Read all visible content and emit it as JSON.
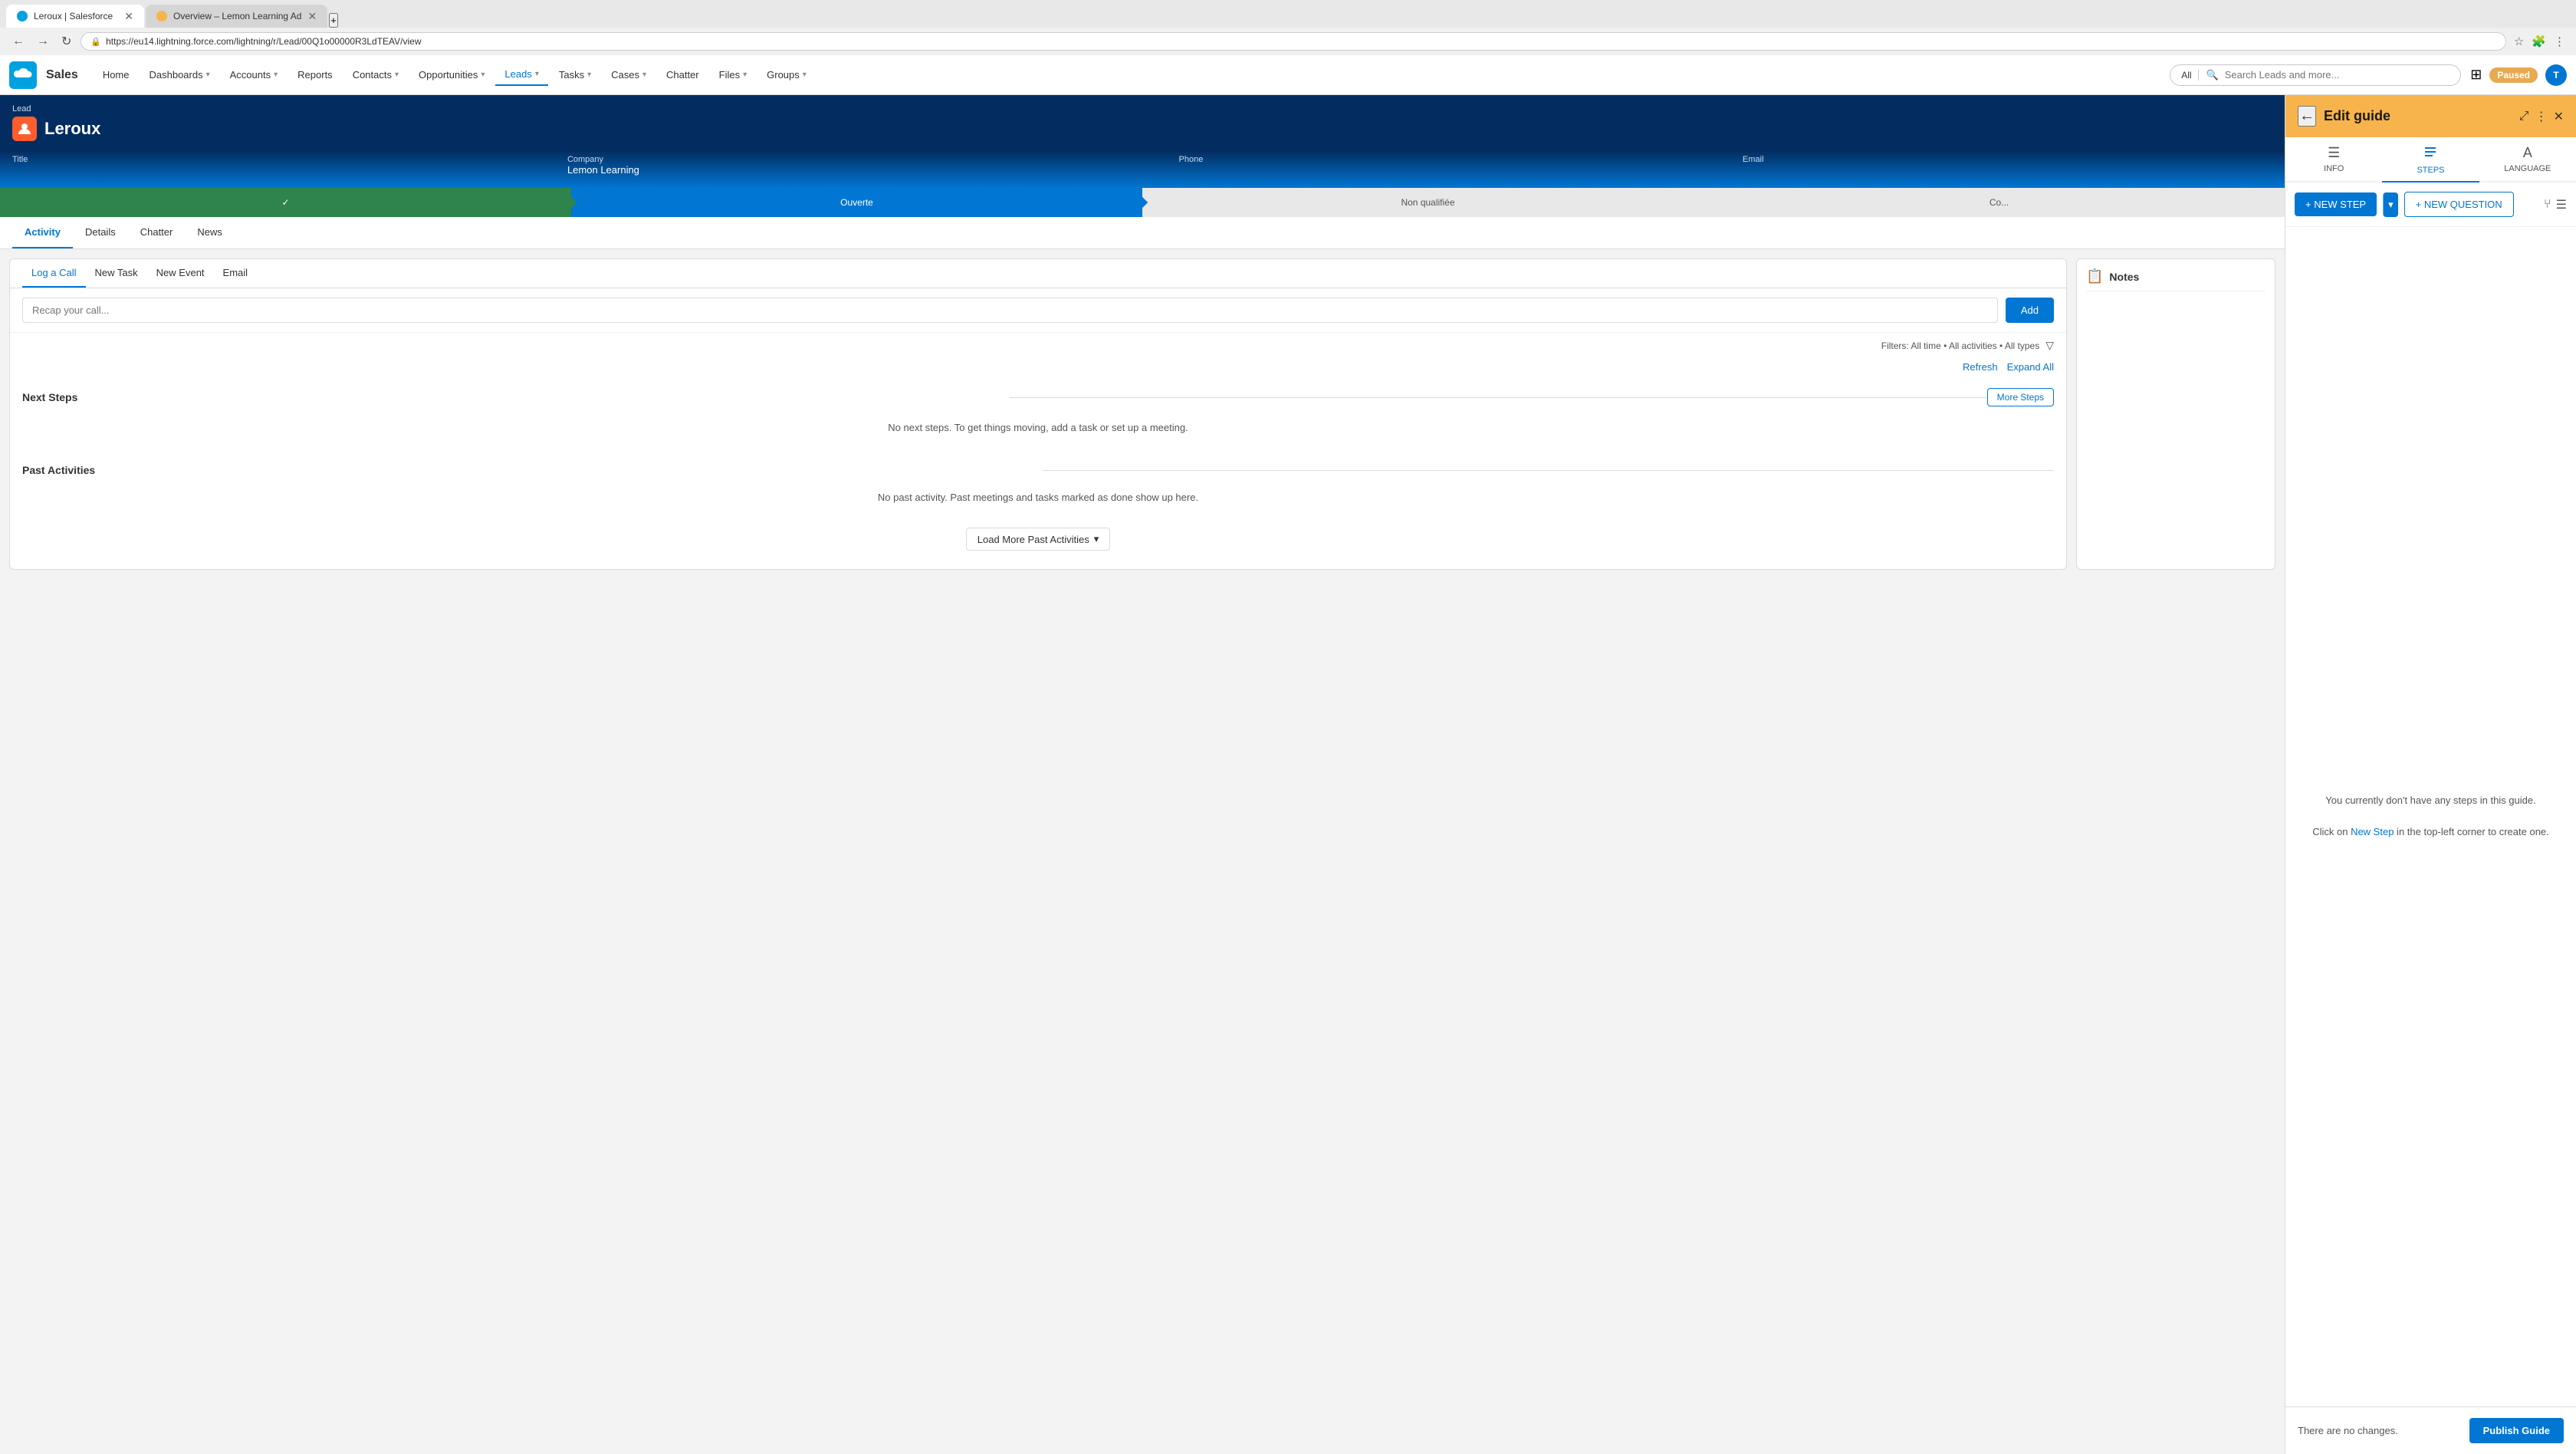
{
  "browser": {
    "tabs": [
      {
        "id": "tab1",
        "label": "Leroux | Salesforce",
        "favicon_type": "sf",
        "active": true
      },
      {
        "id": "tab2",
        "label": "Overview – Lemon Learning Ad",
        "favicon_type": "lemon",
        "active": false
      }
    ],
    "new_tab_label": "+",
    "address_bar_url": "https://eu14.lightning.force.com/lightning/r/Lead/00Q1o00000R3LdTEAV/view",
    "nav_back": "←",
    "nav_forward": "→",
    "nav_refresh": "↻"
  },
  "salesforce": {
    "logo_text": "S",
    "app_name": "Sales",
    "nav_items": [
      {
        "label": "Home",
        "has_dropdown": false
      },
      {
        "label": "Dashboards",
        "has_dropdown": true
      },
      {
        "label": "Accounts",
        "has_dropdown": true
      },
      {
        "label": "Reports",
        "has_dropdown": false
      },
      {
        "label": "Contacts",
        "has_dropdown": true
      },
      {
        "label": "Opportunities",
        "has_dropdown": true
      },
      {
        "label": "Leads",
        "has_dropdown": true,
        "active": true
      },
      {
        "label": "Tasks",
        "has_dropdown": true
      },
      {
        "label": "Cases",
        "has_dropdown": true
      },
      {
        "label": "Chatter",
        "has_dropdown": false
      },
      {
        "label": "Files",
        "has_dropdown": true
      },
      {
        "label": "Groups",
        "has_dropdown": true
      }
    ],
    "search_scope": "All",
    "search_placeholder": "Search Leads and more...",
    "header_right": {
      "paused_label": "Paused",
      "avatar_letter": "T"
    }
  },
  "lead": {
    "breadcrumb": "Lead",
    "name": "Leroux",
    "icon_letter": "L",
    "fields": {
      "title_label": "Title",
      "title_value": "",
      "company_label": "Company",
      "company_value": "Lemon Learning",
      "phone_label": "Phone",
      "phone_value": "",
      "email_label": "Email",
      "email_value": ""
    },
    "status_steps": [
      {
        "label": "✓",
        "state": "done"
      },
      {
        "label": "Ouverte",
        "state": "active"
      },
      {
        "label": "Non qualifiée",
        "state": "inactive"
      },
      {
        "label": "Co...",
        "state": "inactive"
      }
    ]
  },
  "tabs": {
    "items": [
      {
        "label": "Activity",
        "active": true
      },
      {
        "label": "Details",
        "active": false
      },
      {
        "label": "Chatter",
        "active": false
      },
      {
        "label": "News",
        "active": false
      }
    ]
  },
  "activity": {
    "sub_tabs": [
      {
        "label": "Log a Call",
        "active": true
      },
      {
        "label": "New Task",
        "active": false
      },
      {
        "label": "New Event",
        "active": false
      },
      {
        "label": "Email",
        "active": false
      }
    ],
    "recap_placeholder": "Recap your call...",
    "add_button_label": "Add",
    "filters_label": "Filters: All time • All activities • All types",
    "refresh_label": "Refresh",
    "expand_all_label": "Expand All",
    "next_steps_title": "Next Steps",
    "more_steps_label": "More Steps",
    "next_steps_empty": "No next steps. To get things moving, add a task or set up a meeting.",
    "past_activities_title": "Past Activities",
    "past_activities_empty": "No past activity. Past meetings and tasks marked as done show up here.",
    "load_more_label": "Load More Past Activities",
    "load_more_dropdown": "▾"
  },
  "notes": {
    "title": "Notes",
    "icon": "📋"
  },
  "edit_guide": {
    "title": "Edit guide",
    "tabs": [
      {
        "label": "INFO",
        "icon": "☰",
        "active": false
      },
      {
        "label": "STEPS",
        "icon": "☰",
        "active": true
      },
      {
        "label": "LANGUAGE",
        "icon": "A",
        "active": false
      }
    ],
    "new_step_label": "+ NEW STEP",
    "new_question_label": "+ NEW QUESTION",
    "empty_state_text": "You currently don't have any steps in this guide.",
    "empty_state_hint_pre": "Click on ",
    "empty_state_hint_link": "New Step",
    "empty_state_hint_post": " in the top-left corner to create one.",
    "no_changes_text": "There are no changes.",
    "publish_button_label": "Publish Guide"
  }
}
